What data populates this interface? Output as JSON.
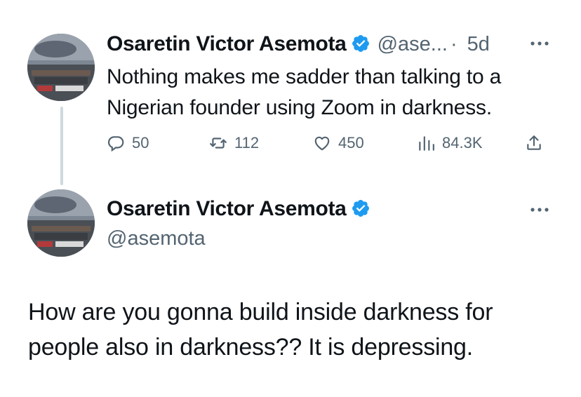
{
  "colors": {
    "text_primary": "#0f1419",
    "text_secondary": "#536471",
    "verified_blue": "#1d9bf0",
    "thread_line": "#cfd9de"
  },
  "tweet1": {
    "author_name": "Osaretin Victor Asemota",
    "handle": "@ase...",
    "separator": "·",
    "time": "5d",
    "text": "Nothing makes me sadder than talking to a Nigerian founder using Zoom in darkness.",
    "actions": {
      "replies": "50",
      "retweets": "112",
      "likes": "450",
      "views": "84.3K"
    }
  },
  "tweet2": {
    "author_name": "Osaretin Victor Asemota",
    "handle": "@asemota",
    "text": "How are you gonna build inside darkness for people also in darkness?? It is depressing."
  },
  "icons": {
    "verified": "verified-badge-icon",
    "more": "more-dots-icon",
    "reply": "reply-icon",
    "retweet": "retweet-icon",
    "like": "heart-icon",
    "views": "views-icon",
    "share": "share-icon"
  }
}
